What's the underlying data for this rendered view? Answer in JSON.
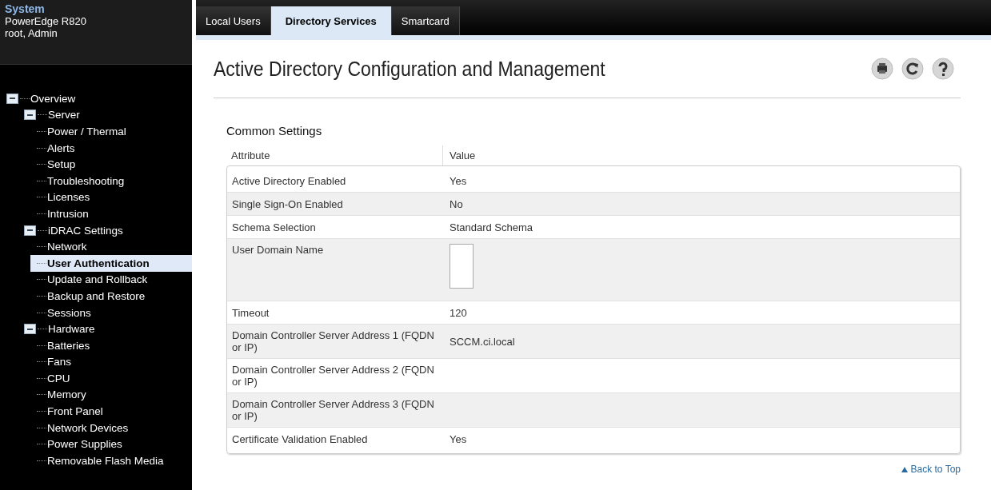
{
  "system": {
    "title": "System",
    "model": "PowerEdge R820",
    "user": "root, Admin"
  },
  "tree": [
    {
      "label": "Overview",
      "expanded": true,
      "selected": false,
      "children": [
        {
          "label": "Server",
          "expanded": true,
          "selected": false,
          "children": [
            {
              "label": "Power / Thermal",
              "selected": false
            },
            {
              "label": "Alerts",
              "selected": false
            },
            {
              "label": "Setup",
              "selected": false
            },
            {
              "label": "Troubleshooting",
              "selected": false
            },
            {
              "label": "Licenses",
              "selected": false
            },
            {
              "label": "Intrusion",
              "selected": false
            }
          ]
        },
        {
          "label": "iDRAC Settings",
          "expanded": true,
          "selected": false,
          "children": [
            {
              "label": "Network",
              "selected": false
            },
            {
              "label": "User Authentication",
              "selected": true
            },
            {
              "label": "Update and Rollback",
              "selected": false
            },
            {
              "label": "Backup and Restore",
              "selected": false
            },
            {
              "label": "Sessions",
              "selected": false
            }
          ]
        },
        {
          "label": "Hardware",
          "expanded": true,
          "selected": false,
          "children": [
            {
              "label": "Batteries",
              "selected": false
            },
            {
              "label": "Fans",
              "selected": false
            },
            {
              "label": "CPU",
              "selected": false
            },
            {
              "label": "Memory",
              "selected": false
            },
            {
              "label": "Front Panel",
              "selected": false
            },
            {
              "label": "Network Devices",
              "selected": false
            },
            {
              "label": "Power Supplies",
              "selected": false
            },
            {
              "label": "Removable Flash Media",
              "selected": false
            }
          ]
        }
      ]
    }
  ],
  "tabs": [
    {
      "label": "Local Users",
      "selected": false
    },
    {
      "label": "Directory Services",
      "selected": true
    },
    {
      "label": "Smartcard",
      "selected": false
    }
  ],
  "page_title": "Active Directory Configuration and Management",
  "section_title": "Common Settings",
  "table": {
    "columns": [
      "Attribute",
      "Value"
    ],
    "rows": [
      {
        "kind": "text",
        "attribute": "Active Directory Enabled",
        "value": "Yes"
      },
      {
        "kind": "text",
        "attribute": "Single Sign-On Enabled",
        "value": "No"
      },
      {
        "kind": "text",
        "attribute": "Schema Selection",
        "value": "Standard Schema"
      },
      {
        "kind": "input",
        "attribute": "User Domain Name"
      },
      {
        "kind": "text",
        "attribute": "Timeout",
        "value": "120"
      },
      {
        "kind": "text",
        "attribute": "Domain Controller Server Address 1 (FQDN or IP)",
        "value": "SCCM.ci.local"
      },
      {
        "kind": "text",
        "attribute": "Domain Controller Server Address 2 (FQDN or IP)"
      },
      {
        "kind": "text",
        "attribute": "Domain Controller Server Address 3 (FQDN or IP)"
      },
      {
        "kind": "text",
        "attribute": "Certificate Validation Enabled",
        "value": "Yes"
      }
    ]
  },
  "back_to_top": "Back to Top"
}
